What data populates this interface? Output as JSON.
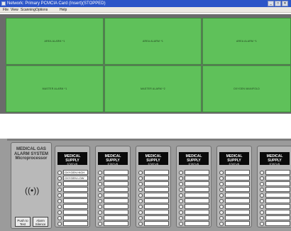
{
  "window": {
    "title": "Network: Primary PCMCIA Card (Insert)(STOPPED)",
    "buttons": [
      "_",
      "□",
      "✕"
    ]
  },
  "menu": [
    "File",
    "View",
    "Scanning",
    "Options",
    "Help"
  ],
  "tiles": [
    "AREA ALARM *1",
    "AREA ALARM *1",
    "AREA ALARM *1",
    "MASTER ALARM *1",
    "MASTER ALARM *2",
    "OXYGEN MANIFOLD"
  ],
  "controller": {
    "title_lines": [
      "MEDICAL GAS",
      "ALARM SYSTEM",
      "Microprocessor"
    ],
    "speaker_icon": "speaker-icon",
    "test_button": "Push to Test",
    "silence_button": "Alarm Silence"
  },
  "modules": [
    {
      "label": "MEDICAL SUPPLY",
      "sub": "STATUS",
      "rows": [
        "OXYGEN HIGH",
        "OXYGEN LOW",
        "",
        "",
        "",
        "",
        "",
        "",
        "",
        ""
      ]
    },
    {
      "label": "MEDICAL SUPPLY",
      "sub": "STATUS",
      "rows": [
        "",
        "",
        "",
        "",
        "",
        "",
        "",
        "",
        "",
        ""
      ]
    },
    {
      "label": "MEDICAL SUPPLY",
      "sub": "STATUS",
      "rows": [
        "",
        "",
        "",
        "",
        "",
        "",
        "",
        "",
        "",
        ""
      ]
    },
    {
      "label": "MEDICAL SUPPLY",
      "sub": "STATUS",
      "rows": [
        "",
        "",
        "",
        "",
        "",
        "",
        "",
        "",
        "",
        ""
      ]
    },
    {
      "label": "MEDICAL SUPPLY",
      "sub": "STATUS",
      "rows": [
        "",
        "",
        "",
        "",
        "",
        "",
        "",
        "",
        "",
        ""
      ]
    },
    {
      "label": "MEDICAL SUPPLY",
      "sub": "STATUS",
      "rows": [
        "",
        "",
        "",
        "",
        "",
        "",
        "",
        "",
        "",
        ""
      ]
    }
  ],
  "colors": {
    "tile_green": "#5fc15a",
    "titlebar_blue": "#2b55c8",
    "panel_gray": "#9b9b9b"
  }
}
